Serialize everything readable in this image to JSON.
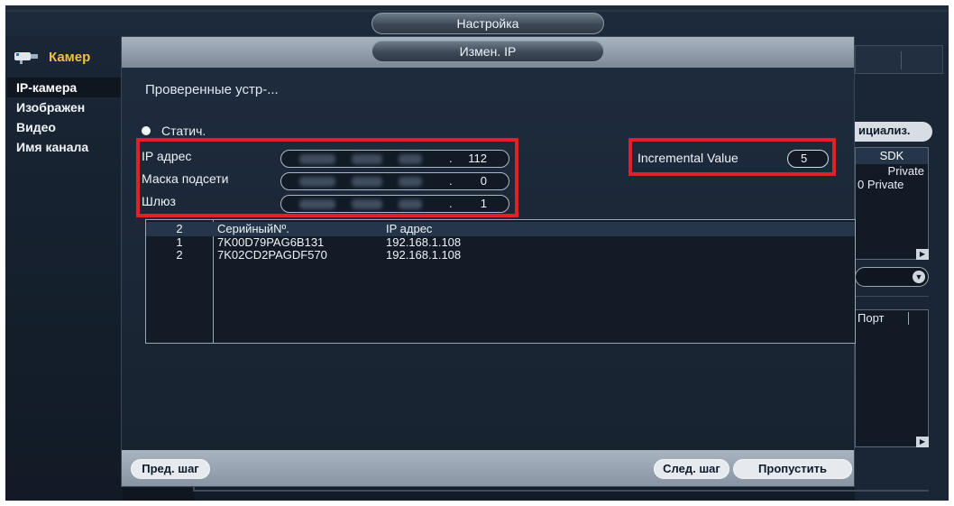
{
  "window": {
    "title": "Настройка"
  },
  "background": {
    "section_title": "Камер",
    "menu": [
      "IP-камера",
      "Изображен",
      "Видео",
      "Имя канала"
    ],
    "init_button": "ициализ.",
    "table_header": "SDK",
    "table_rows": [
      "Private",
      "0 Private"
    ],
    "port_header": "Порт"
  },
  "dialog": {
    "title": "Измен. IP",
    "section_title": "Проверенные устр-...",
    "mode_label": "Статич.",
    "fields": {
      "ip": {
        "label": "IP адрес",
        "last_octet": "112"
      },
      "mask": {
        "label": "Маска подсети",
        "last_octet": "0"
      },
      "gateway": {
        "label": "Шлюз",
        "last_octet": "1"
      }
    },
    "incremental": {
      "label": "Incremental Value",
      "value": "5"
    },
    "table": {
      "headers": {
        "count": "2",
        "serial": "СерийныйNº.",
        "ip": "IP адрес"
      },
      "rows": [
        {
          "idx": "1",
          "serial": "7K00D79PAG6B131",
          "ip": "192.168.1.108"
        },
        {
          "idx": "2",
          "serial": "7K02CD2PAGDF570",
          "ip": "192.168.1.108"
        }
      ]
    },
    "buttons": {
      "prev": "Пред. шаг",
      "next": "След. шаг",
      "skip": "Пропустить"
    }
  },
  "colors": {
    "highlight": "#e0202a",
    "accent": "#f0c040"
  }
}
